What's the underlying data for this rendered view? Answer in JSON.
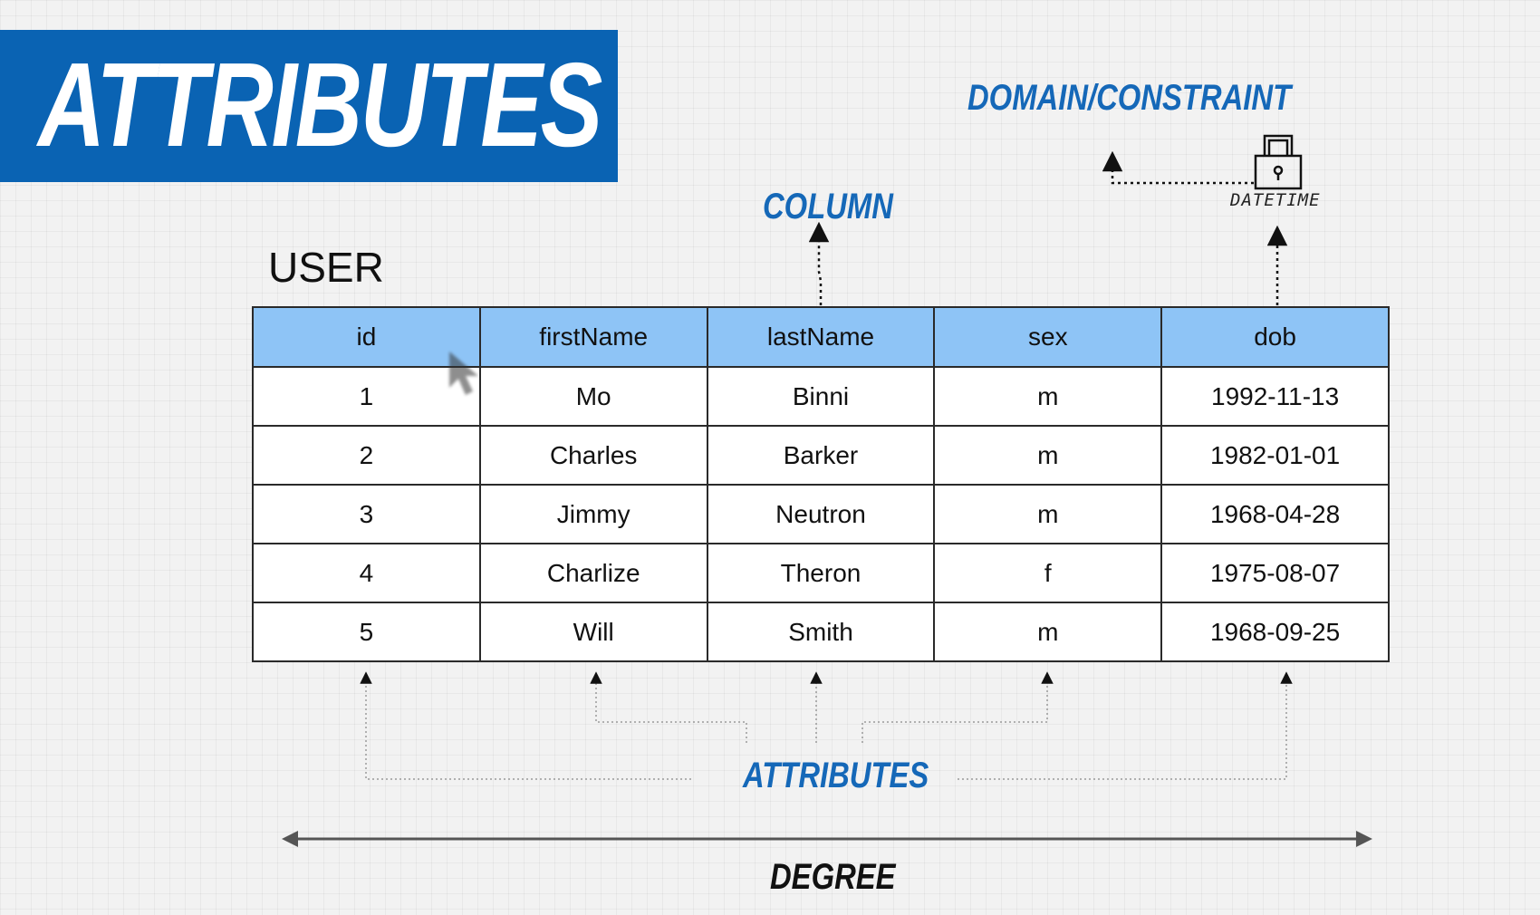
{
  "title": "ATTRIBUTES",
  "table": {
    "name": "USER",
    "columns": [
      "id",
      "firstName",
      "lastName",
      "sex",
      "dob"
    ],
    "rows": [
      [
        "1",
        "Mo",
        "Binni",
        "m",
        "1992-11-13"
      ],
      [
        "2",
        "Charles",
        "Barker",
        "m",
        "1982-01-01"
      ],
      [
        "3",
        "Jimmy",
        "Neutron",
        "m",
        "1968-04-28"
      ],
      [
        "4",
        "Charlize",
        "Theron",
        "f",
        "1975-08-07"
      ],
      [
        "5",
        "Will",
        "Smith",
        "m",
        "1968-09-25"
      ]
    ]
  },
  "annotations": {
    "column_label": "COLUMN",
    "domain_label": "DOMAIN/CONSTRAINT",
    "datetime_label": "DATETIME",
    "attributes_label": "ATTRIBUTES",
    "degree_label": "DEGREE"
  },
  "colors": {
    "banner": "#0a63b3",
    "header": "#8ec4f6",
    "accent_text": "#1568b8"
  },
  "icons": [
    "lock-icon",
    "mouse-cursor-icon"
  ]
}
